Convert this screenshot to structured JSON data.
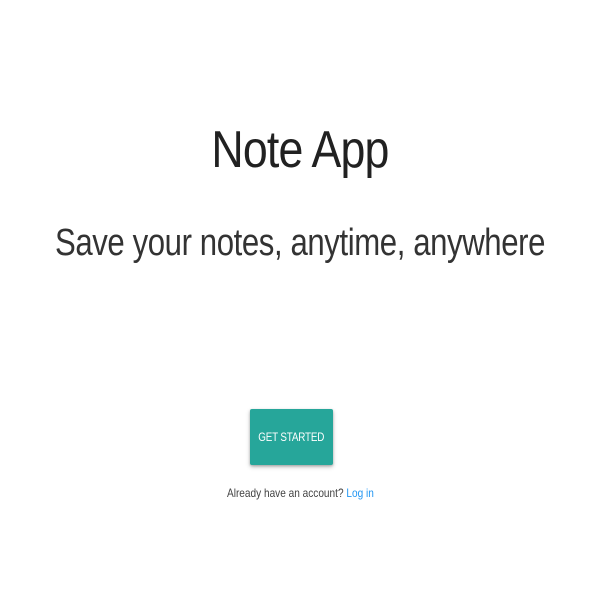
{
  "hero": {
    "title": "Note App",
    "subtitle": "Save your notes, anytime, anywhere"
  },
  "cta": {
    "label": "GET STARTED"
  },
  "login": {
    "prompt": "Already have an account?",
    "link_label": "Log in"
  },
  "colors": {
    "accent": "#26a69a",
    "link": "#2196f3",
    "text": "#212121",
    "background": "#ffffff"
  }
}
